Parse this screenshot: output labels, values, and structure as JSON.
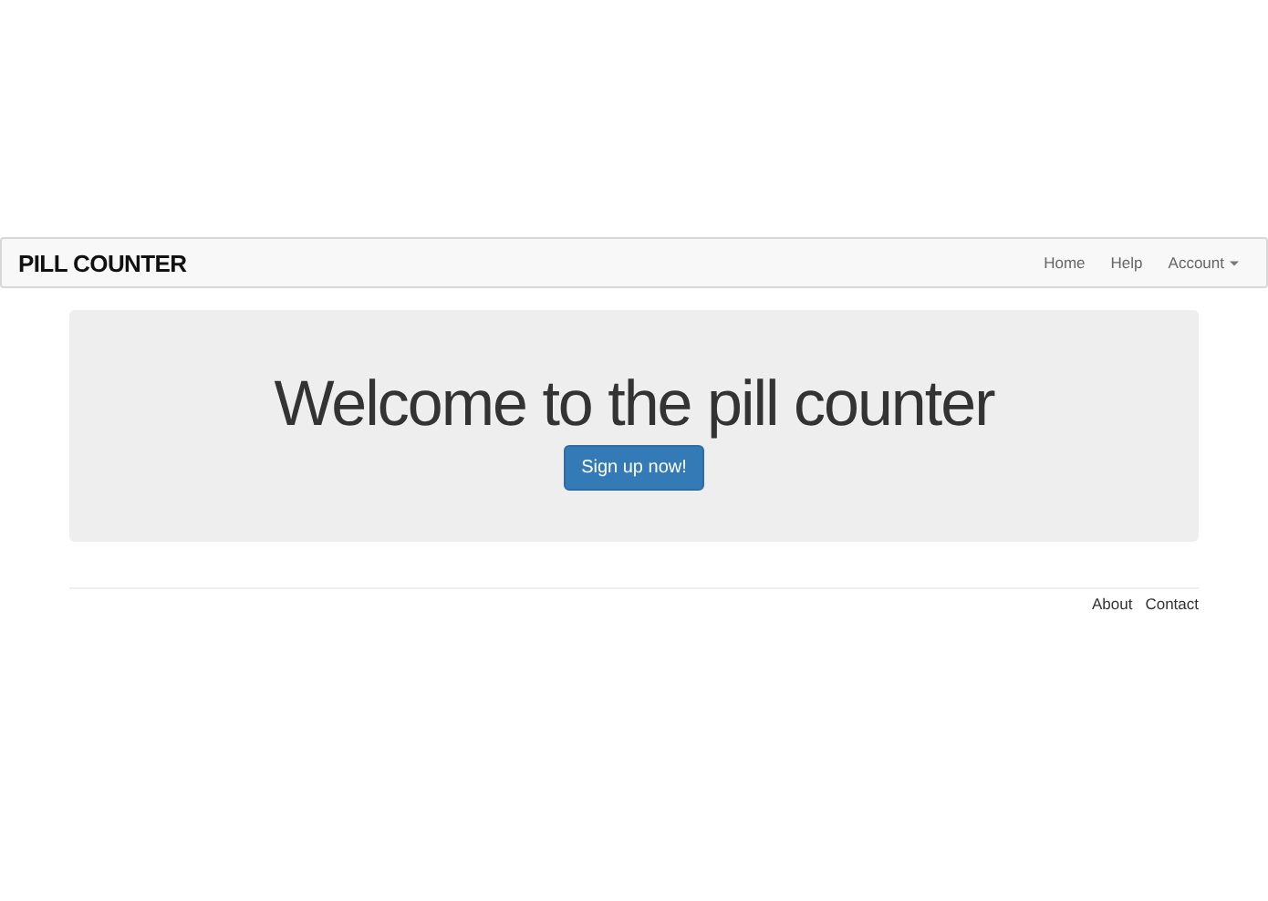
{
  "navbar": {
    "brand": "PILL COUNTER",
    "links": [
      {
        "label": "Home",
        "kind": "link"
      },
      {
        "label": "Help",
        "kind": "link"
      },
      {
        "label": "Account",
        "kind": "dropdown"
      }
    ]
  },
  "hero": {
    "heading": "Welcome to the pill counter",
    "button": "Sign up now!"
  },
  "footer": {
    "links": [
      "About",
      "Contact"
    ]
  }
}
